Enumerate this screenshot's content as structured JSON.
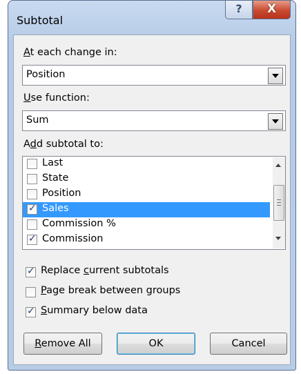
{
  "window": {
    "title": "Subtotal",
    "help_label": "?",
    "close_label": "X"
  },
  "change_in": {
    "label_accel": "A",
    "label_rest": "t each change in:",
    "value": "Position"
  },
  "function": {
    "label_accel": "U",
    "label_rest": "se function:",
    "value": "Sum"
  },
  "add_subtotal": {
    "label_pre": "A",
    "label_accel": "d",
    "label_rest": "d subtotal to:",
    "items": [
      {
        "label": "Last",
        "checked": false,
        "selected": false
      },
      {
        "label": "State",
        "checked": false,
        "selected": false
      },
      {
        "label": "Position",
        "checked": false,
        "selected": false
      },
      {
        "label": "Sales",
        "checked": true,
        "selected": true
      },
      {
        "label": "Commission %",
        "checked": false,
        "selected": false
      },
      {
        "label": "Commission",
        "checked": true,
        "selected": false
      }
    ]
  },
  "options": {
    "replace": {
      "pre": "Replace ",
      "accel": "c",
      "rest": "urrent subtotals",
      "checked": true
    },
    "page_break": {
      "pre": "",
      "accel": "P",
      "rest": "age break between groups",
      "checked": false
    },
    "summary": {
      "pre": "",
      "accel": "S",
      "rest": "ummary below data",
      "checked": true
    }
  },
  "buttons": {
    "remove_all_accel": "R",
    "remove_all_rest": "emove All",
    "ok": "OK",
    "cancel": "Cancel"
  },
  "colors": {
    "selection": "#3399ff",
    "close_button": "#c94a31",
    "frame": "#b6cbe7"
  }
}
